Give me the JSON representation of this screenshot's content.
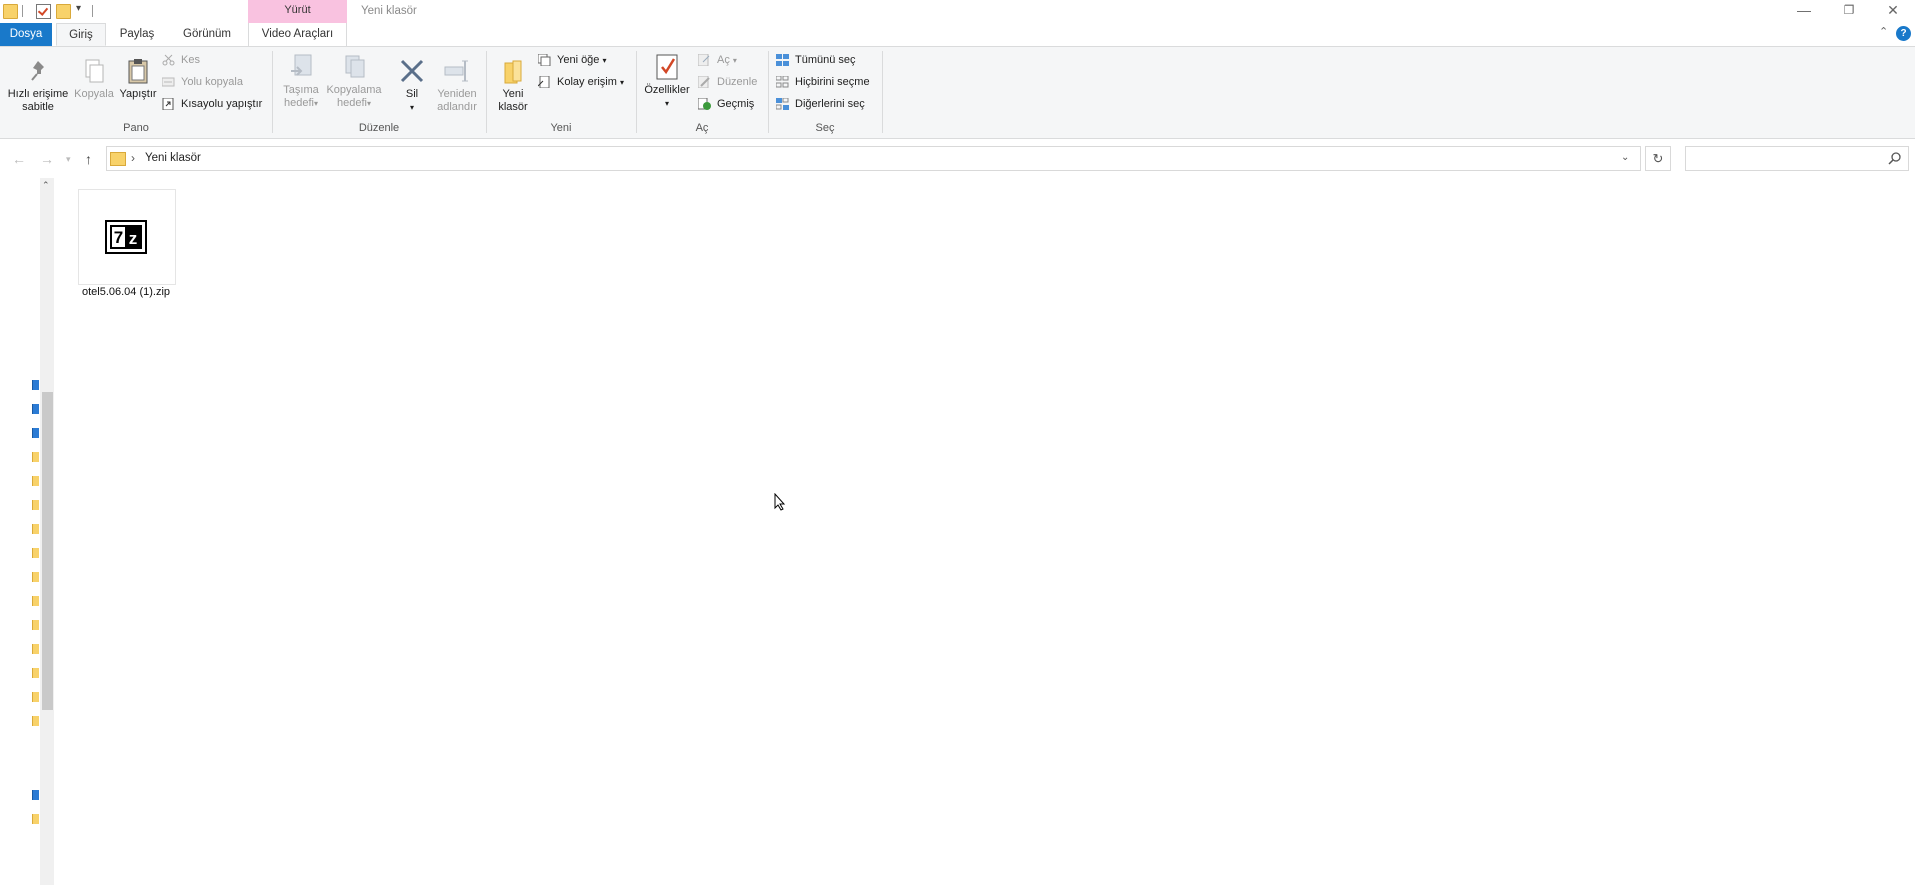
{
  "window": {
    "title": "Yeni klasör",
    "context_tab_header": "Yürüt",
    "controls": {
      "minimize": "—",
      "restore": "❐",
      "close": "✕"
    }
  },
  "tabs": {
    "file": "Dosya",
    "home": "Giriş",
    "share": "Paylaş",
    "view": "Görünüm",
    "video": "Video Araçları",
    "help": "?",
    "collapse": "⌃"
  },
  "ribbon": {
    "clipboard": {
      "pin_line1": "Hızlı erişime",
      "pin_line2": "sabitle",
      "copy": "Kopyala",
      "paste": "Yapıştır",
      "cut": "Kes",
      "copy_path": "Yolu kopyala",
      "paste_shortcut": "Kısayolu yapıştır",
      "label": "Pano"
    },
    "organize": {
      "move_line1": "Taşıma",
      "move_line2": "hedefi",
      "copyto_line1": "Kopyalama",
      "copyto_line2": "hedefi",
      "delete": "Sil",
      "rename_line1": "Yeniden",
      "rename_line2": "adlandır",
      "label": "Düzenle"
    },
    "new": {
      "new_folder_line1": "Yeni",
      "new_folder_line2": "klasör",
      "new_item": "Yeni öğe",
      "easy_access": "Kolay erişim",
      "label": "Yeni"
    },
    "open": {
      "properties": "Özellikler",
      "open": "Aç",
      "edit": "Düzenle",
      "history": "Geçmiş",
      "label": "Aç"
    },
    "select": {
      "select_all": "Tümünü seç",
      "select_none": "Hiçbirini seçme",
      "invert": "Diğerlerini seç",
      "label": "Seç"
    }
  },
  "address": {
    "separator": "›",
    "path": "Yeni klasör",
    "search_placeholder": ""
  },
  "files": [
    {
      "name": "otel5.06.04 (1).zip",
      "icon": "7z-archive-icon",
      "icon_text": "7z"
    }
  ]
}
